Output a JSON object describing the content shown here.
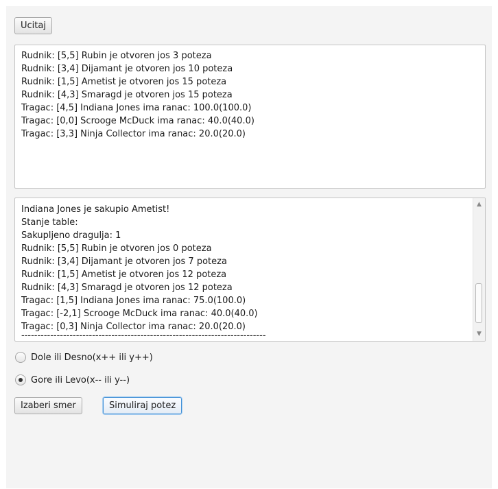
{
  "toolbar": {
    "load_label": "Ucitaj"
  },
  "status_area": {
    "lines": [
      "Rudnik: [5,5] Rubin je otvoren jos 3 poteza",
      "Rudnik: [3,4] Dijamant je otvoren jos 10 poteza",
      "Rudnik: [1,5] Ametist je otvoren jos 15 poteza",
      "Rudnik: [4,3] Smaragd je otvoren jos 15 poteza",
      "Tragac: [4,5] Indiana Jones ima ranac: 100.0(100.0)",
      "Tragac: [0,0] Scrooge McDuck ima ranac: 40.0(40.0)",
      "Tragac: [3,3] Ninja Collector ima ranac: 20.0(20.0)"
    ]
  },
  "log_area": {
    "lines": [
      "Indiana Jones je sakupio Ametist!",
      "Stanje table:",
      "Sakupljeno dragulja: 1",
      "Rudnik: [5,5] Rubin je otvoren jos 0 poteza",
      "Rudnik: [3,4] Dijamant je otvoren jos 7 poteza",
      "Rudnik: [1,5] Ametist je otvoren jos 12 poteza",
      "Rudnik: [4,3] Smaragd je otvoren jos 12 poteza",
      "Tragac: [1,5] Indiana Jones ima ranac: 75.0(100.0)",
      "Tragac: [-2,1] Scrooge McDuck ima ranac: 40.0(40.0)",
      "Tragac: [0,3] Ninja Collector ima ranac: 20.0(20.0)",
      "----------------------------------------------------------------------------"
    ],
    "scroll_up_icon": "chevron-up",
    "scroll_down_icon": "chevron-down"
  },
  "direction": {
    "options": [
      {
        "label": "Dole ili Desno(x++ ili y++)",
        "selected": false
      },
      {
        "label": "Gore ili Levo(x-- ili y--)",
        "selected": true
      }
    ]
  },
  "actions": {
    "choose_direction_label": "Izaberi smer",
    "simulate_label": "Simuliraj potez"
  }
}
